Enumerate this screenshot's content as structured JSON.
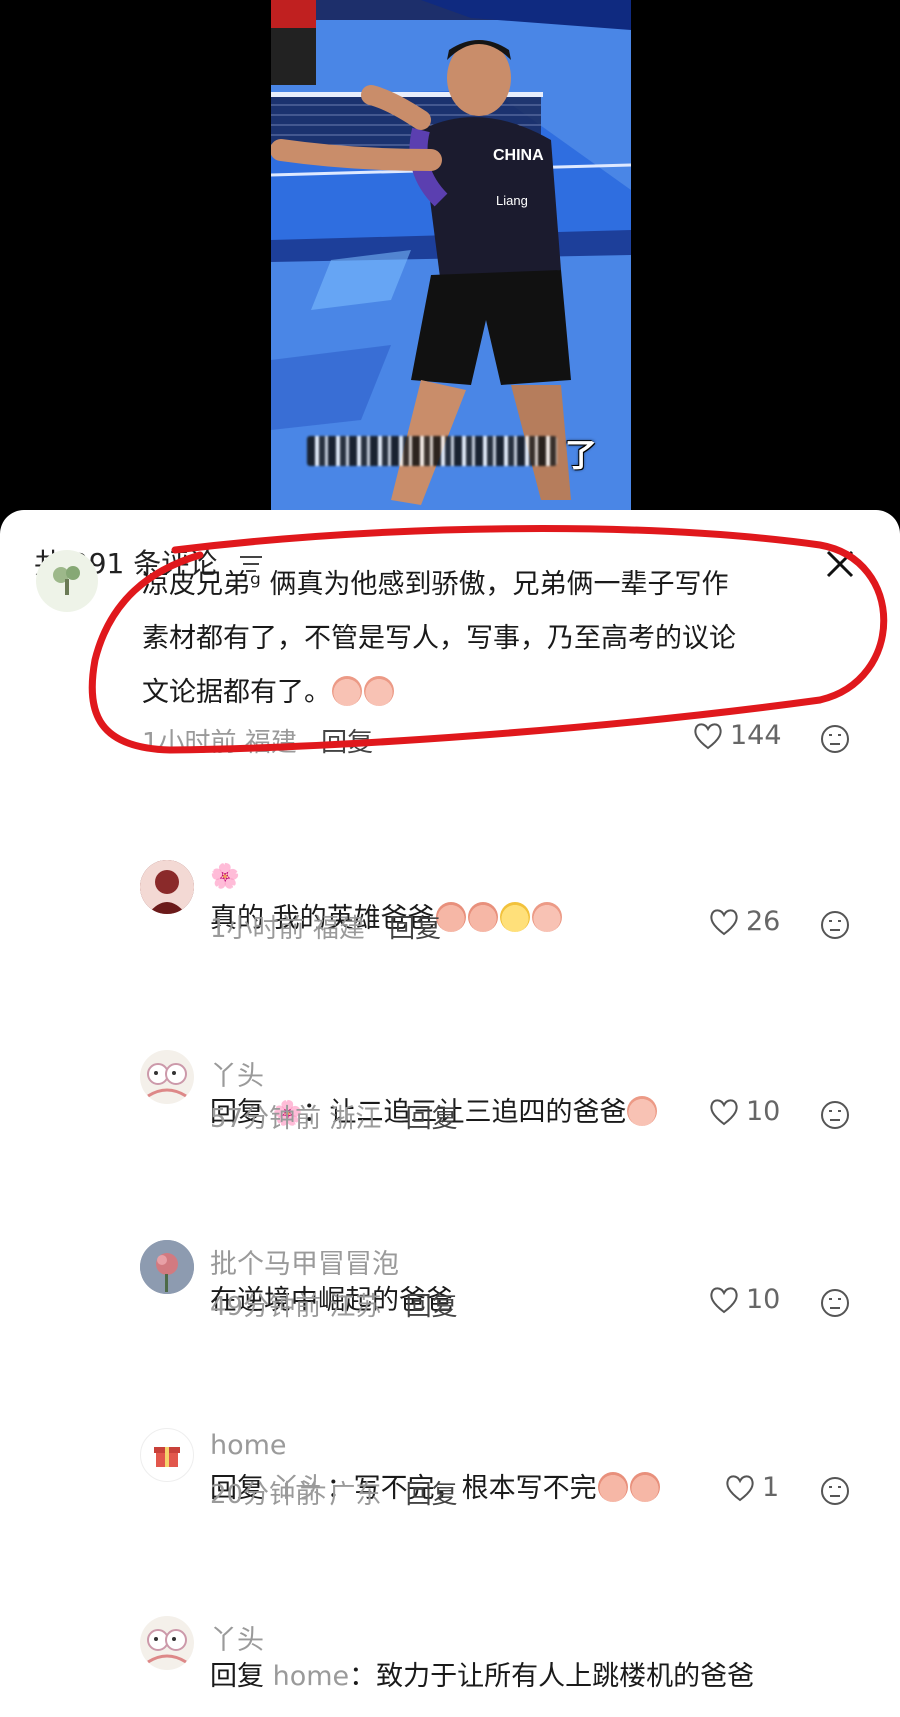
{
  "video": {
    "caption_tail": "了",
    "jersey_text": "CHINA",
    "jersey_name": "Liang"
  },
  "header": {
    "count_label": "共 291 条评论"
  },
  "comments": [
    {
      "nickname": "",
      "text_lines": [
        "凉皮兄弟ᵍ 俩真为他感到骄傲，兄弟俩一辈子写作",
        "素材都有了，不管是写人，写事，乃至高考的议论",
        "文论据都有了。"
      ],
      "time": "1小时前",
      "location": "福建",
      "reply_label": "回复",
      "likes": "144"
    },
    {
      "nickname": "🌸",
      "text": "真的  我的英雄爸爸",
      "time": "1小时前",
      "location": "福建",
      "reply_label": "回复",
      "likes": "26"
    },
    {
      "nickname": "丫头",
      "reply_prefix": "回复",
      "reply_to": "🌸",
      "text": "：让二追三让三追四的爸爸",
      "time": "57分钟前",
      "location": "浙江",
      "reply_label": "回复",
      "likes": "10"
    },
    {
      "nickname": "批个马甲冒冒泡",
      "text": "在逆境中崛起的爸爸",
      "time": "49分钟前",
      "location": "江苏",
      "reply_label": "回复",
      "likes": "10"
    },
    {
      "nickname": "home",
      "reply_prefix": "回复",
      "reply_to": "丫头",
      "text": "：写不完，根本写不完",
      "time": "20分钟前",
      "location": "广东",
      "reply_label": "回复",
      "likes": "1"
    },
    {
      "nickname": "丫头",
      "reply_prefix": "回复",
      "reply_to": "home",
      "text": "：致力于让所有人上跳楼机的爸爸"
    }
  ],
  "icons": {
    "sort": "sort-lines-icon",
    "close": "close-icon",
    "like": "heart-outline-icon",
    "dislike": "dislike-face-icon"
  },
  "colors": {
    "annotation_ring": "#e0181c",
    "meta_gray": "#9a9a9a",
    "sheet_bg": "#ffffff"
  }
}
